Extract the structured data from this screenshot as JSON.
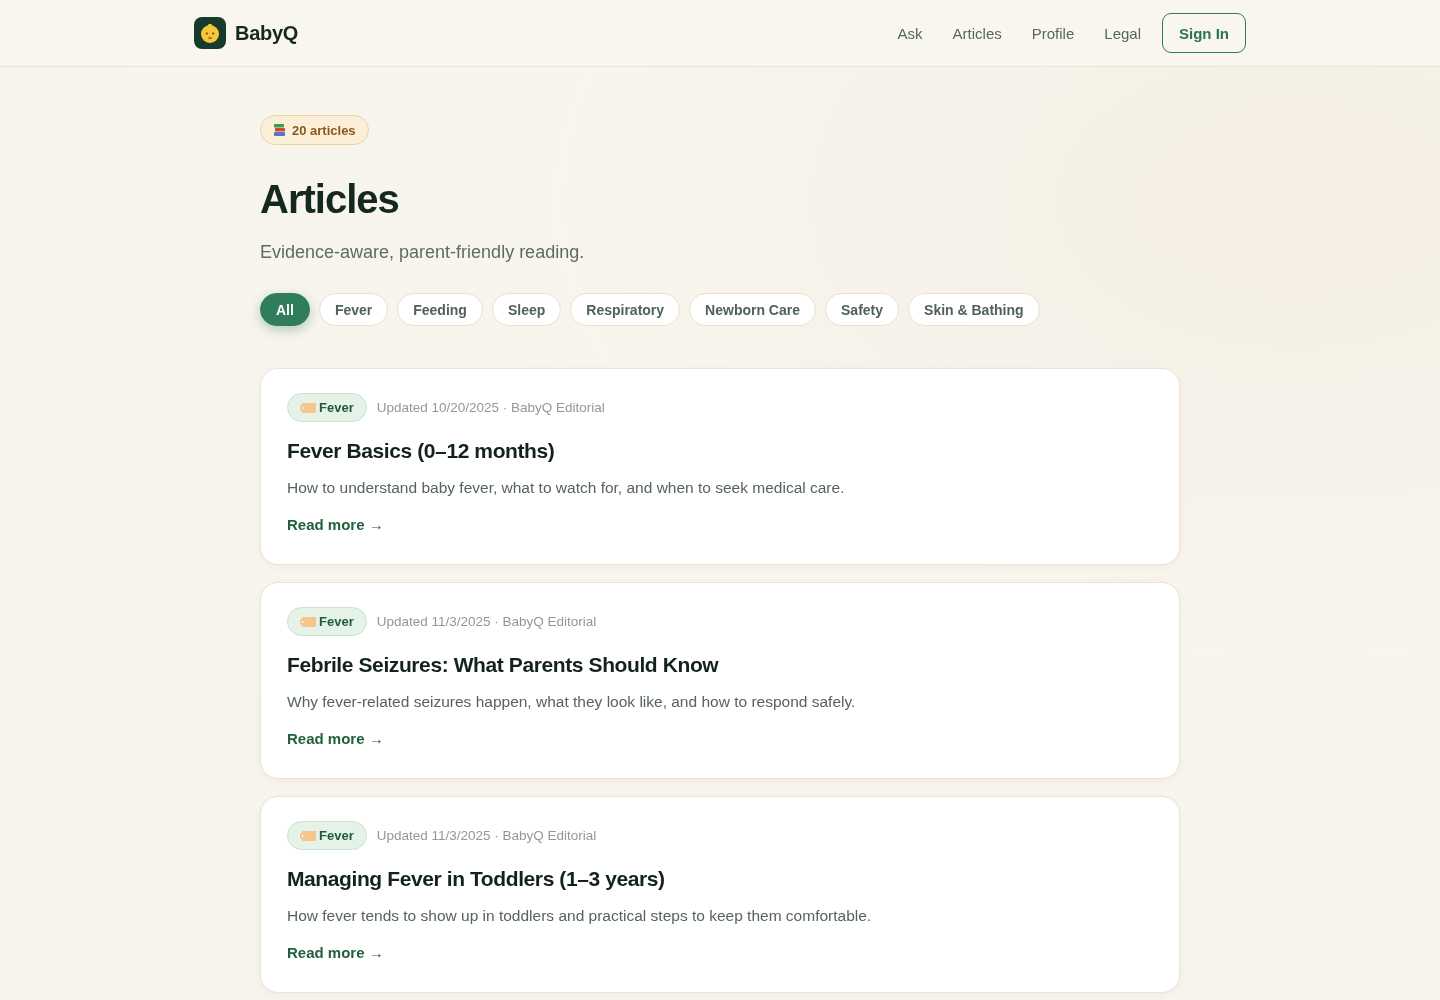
{
  "header": {
    "brand": "BabyQ",
    "nav": [
      "Ask",
      "Articles",
      "Profile",
      "Legal"
    ],
    "sign_in": "Sign In"
  },
  "hero": {
    "badge": "20 articles",
    "title": "Articles",
    "subtitle": "Evidence-aware, parent-friendly reading."
  },
  "filters": [
    {
      "label": "All",
      "selected": true
    },
    {
      "label": "Fever",
      "selected": false
    },
    {
      "label": "Feeding",
      "selected": false
    },
    {
      "label": "Sleep",
      "selected": false
    },
    {
      "label": "Respiratory",
      "selected": false
    },
    {
      "label": "Newborn Care",
      "selected": false
    },
    {
      "label": "Safety",
      "selected": false
    },
    {
      "label": "Skin & Bathing",
      "selected": false
    }
  ],
  "articles": [
    {
      "tag": "Fever",
      "meta": "Updated 10/20/2025 · BabyQ Editorial",
      "title": "Fever Basics (0–12 months)",
      "summary": "How to understand baby fever, what to watch for, and when to seek medical care.",
      "link": "Read more →"
    },
    {
      "tag": "Fever",
      "meta": "Updated 11/3/2025 · BabyQ Editorial",
      "title": "Febrile Seizures: What Parents Should Know",
      "summary": "Why fever-related seizures happen, what they look like, and how to respond safely.",
      "link": "Read more →"
    },
    {
      "tag": "Fever",
      "meta": "Updated 11/3/2025 · BabyQ Editorial",
      "title": "Managing Fever in Toddlers (1–3 years)",
      "summary": "How fever tends to show up in toddlers and practical steps to keep them comfortable.",
      "link": "Read more →"
    }
  ]
}
